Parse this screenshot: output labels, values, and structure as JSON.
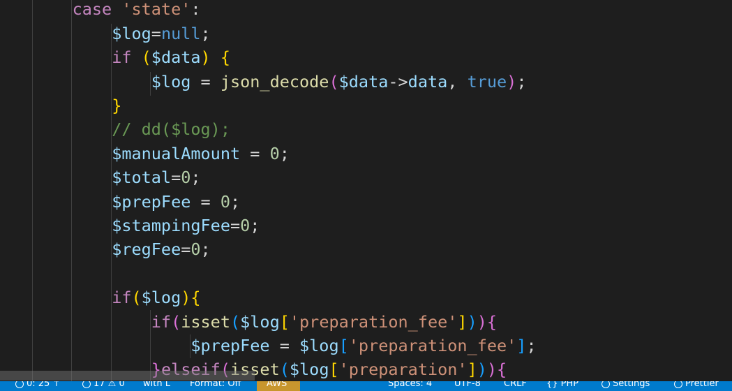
{
  "code_lines": [
    [
      {
        "t": "    ",
        "c": "txt"
      },
      {
        "t": "case ",
        "c": "kw"
      },
      {
        "t": "'state'",
        "c": "str"
      },
      {
        "t": ":",
        "c": "txt"
      }
    ],
    [
      {
        "t": "        ",
        "c": "txt"
      },
      {
        "t": "$log",
        "c": "var"
      },
      {
        "t": "=",
        "c": "txt"
      },
      {
        "t": "null",
        "c": "bool"
      },
      {
        "t": ";",
        "c": "txt"
      }
    ],
    [
      {
        "t": "        ",
        "c": "txt"
      },
      {
        "t": "if ",
        "c": "kw"
      },
      {
        "t": "(",
        "c": "b1"
      },
      {
        "t": "$data",
        "c": "var"
      },
      {
        "t": ")",
        "c": "b1"
      },
      {
        "t": " ",
        "c": "txt"
      },
      {
        "t": "{",
        "c": "b1"
      }
    ],
    [
      {
        "t": "            ",
        "c": "txt"
      },
      {
        "t": "$log",
        "c": "var"
      },
      {
        "t": " = ",
        "c": "txt"
      },
      {
        "t": "json_decode",
        "c": "fn"
      },
      {
        "t": "(",
        "c": "b2"
      },
      {
        "t": "$data",
        "c": "var"
      },
      {
        "t": "->",
        "c": "txt"
      },
      {
        "t": "data",
        "c": "var"
      },
      {
        "t": ", ",
        "c": "txt"
      },
      {
        "t": "true",
        "c": "bool"
      },
      {
        "t": ")",
        "c": "b2"
      },
      {
        "t": ";",
        "c": "txt"
      }
    ],
    [
      {
        "t": "        ",
        "c": "txt"
      },
      {
        "t": "}",
        "c": "b1"
      }
    ],
    [
      {
        "t": "        ",
        "c": "txt"
      },
      {
        "t": "// dd($log);",
        "c": "com"
      }
    ],
    [
      {
        "t": "        ",
        "c": "txt"
      },
      {
        "t": "$manualAmount",
        "c": "var"
      },
      {
        "t": " = ",
        "c": "txt"
      },
      {
        "t": "0",
        "c": "num"
      },
      {
        "t": ";",
        "c": "txt"
      }
    ],
    [
      {
        "t": "        ",
        "c": "txt"
      },
      {
        "t": "$total",
        "c": "var"
      },
      {
        "t": "=",
        "c": "txt"
      },
      {
        "t": "0",
        "c": "num"
      },
      {
        "t": ";",
        "c": "txt"
      }
    ],
    [
      {
        "t": "        ",
        "c": "txt"
      },
      {
        "t": "$prepFee",
        "c": "var"
      },
      {
        "t": " = ",
        "c": "txt"
      },
      {
        "t": "0",
        "c": "num"
      },
      {
        "t": ";",
        "c": "txt"
      }
    ],
    [
      {
        "t": "        ",
        "c": "txt"
      },
      {
        "t": "$stampingFee",
        "c": "var"
      },
      {
        "t": "=",
        "c": "txt"
      },
      {
        "t": "0",
        "c": "num"
      },
      {
        "t": ";",
        "c": "txt"
      }
    ],
    [
      {
        "t": "        ",
        "c": "txt"
      },
      {
        "t": "$regFee",
        "c": "var"
      },
      {
        "t": "=",
        "c": "txt"
      },
      {
        "t": "0",
        "c": "num"
      },
      {
        "t": ";",
        "c": "txt"
      }
    ],
    [],
    [
      {
        "t": "        ",
        "c": "txt"
      },
      {
        "t": "if",
        "c": "kw"
      },
      {
        "t": "(",
        "c": "b1"
      },
      {
        "t": "$log",
        "c": "var"
      },
      {
        "t": ")",
        "c": "b1"
      },
      {
        "t": "{",
        "c": "b1"
      }
    ],
    [
      {
        "t": "            ",
        "c": "txt"
      },
      {
        "t": "if",
        "c": "kw"
      },
      {
        "t": "(",
        "c": "b2"
      },
      {
        "t": "isset",
        "c": "fn"
      },
      {
        "t": "(",
        "c": "b3"
      },
      {
        "t": "$log",
        "c": "var"
      },
      {
        "t": "[",
        "c": "b1"
      },
      {
        "t": "'preparation_fee'",
        "c": "str"
      },
      {
        "t": "]",
        "c": "b1"
      },
      {
        "t": ")",
        "c": "b3"
      },
      {
        "t": ")",
        "c": "b2"
      },
      {
        "t": "{",
        "c": "b2"
      }
    ],
    [
      {
        "t": "                ",
        "c": "txt"
      },
      {
        "t": "$prepFee",
        "c": "var"
      },
      {
        "t": " = ",
        "c": "txt"
      },
      {
        "t": "$log",
        "c": "var"
      },
      {
        "t": "[",
        "c": "b3"
      },
      {
        "t": "'preparation_fee'",
        "c": "str"
      },
      {
        "t": "]",
        "c": "b3"
      },
      {
        "t": ";",
        "c": "txt"
      }
    ],
    [
      {
        "t": "            ",
        "c": "txt"
      },
      {
        "t": "}",
        "c": "b2"
      },
      {
        "t": "elseif",
        "c": "kw"
      },
      {
        "t": "(",
        "c": "b2"
      },
      {
        "t": "isset",
        "c": "fn"
      },
      {
        "t": "(",
        "c": "b3"
      },
      {
        "t": "$log",
        "c": "var"
      },
      {
        "t": "[",
        "c": "b1"
      },
      {
        "t": "'preparation'",
        "c": "str"
      },
      {
        "t": "]",
        "c": "b1"
      },
      {
        "t": ")",
        "c": "b3"
      },
      {
        "t": ")",
        "c": "b2"
      },
      {
        "t": "{",
        "c": "b2"
      }
    ]
  ],
  "statusbar": {
    "remote": "0: 25 ↑",
    "problems": "17 ⚠ 0",
    "live_share": "with L",
    "format": "Format: Off",
    "aws": "AWS",
    "spaces": "Spaces: 4",
    "encoding": "UTF-8",
    "eol": "CRLF",
    "language": "{} PHP",
    "settings": "Settings",
    "prettier": "Prettier"
  },
  "colors": {
    "editor_bg": "#1e1e1e",
    "statusbar_bg": "#007acc",
    "aws_bg": "#c8962e"
  }
}
